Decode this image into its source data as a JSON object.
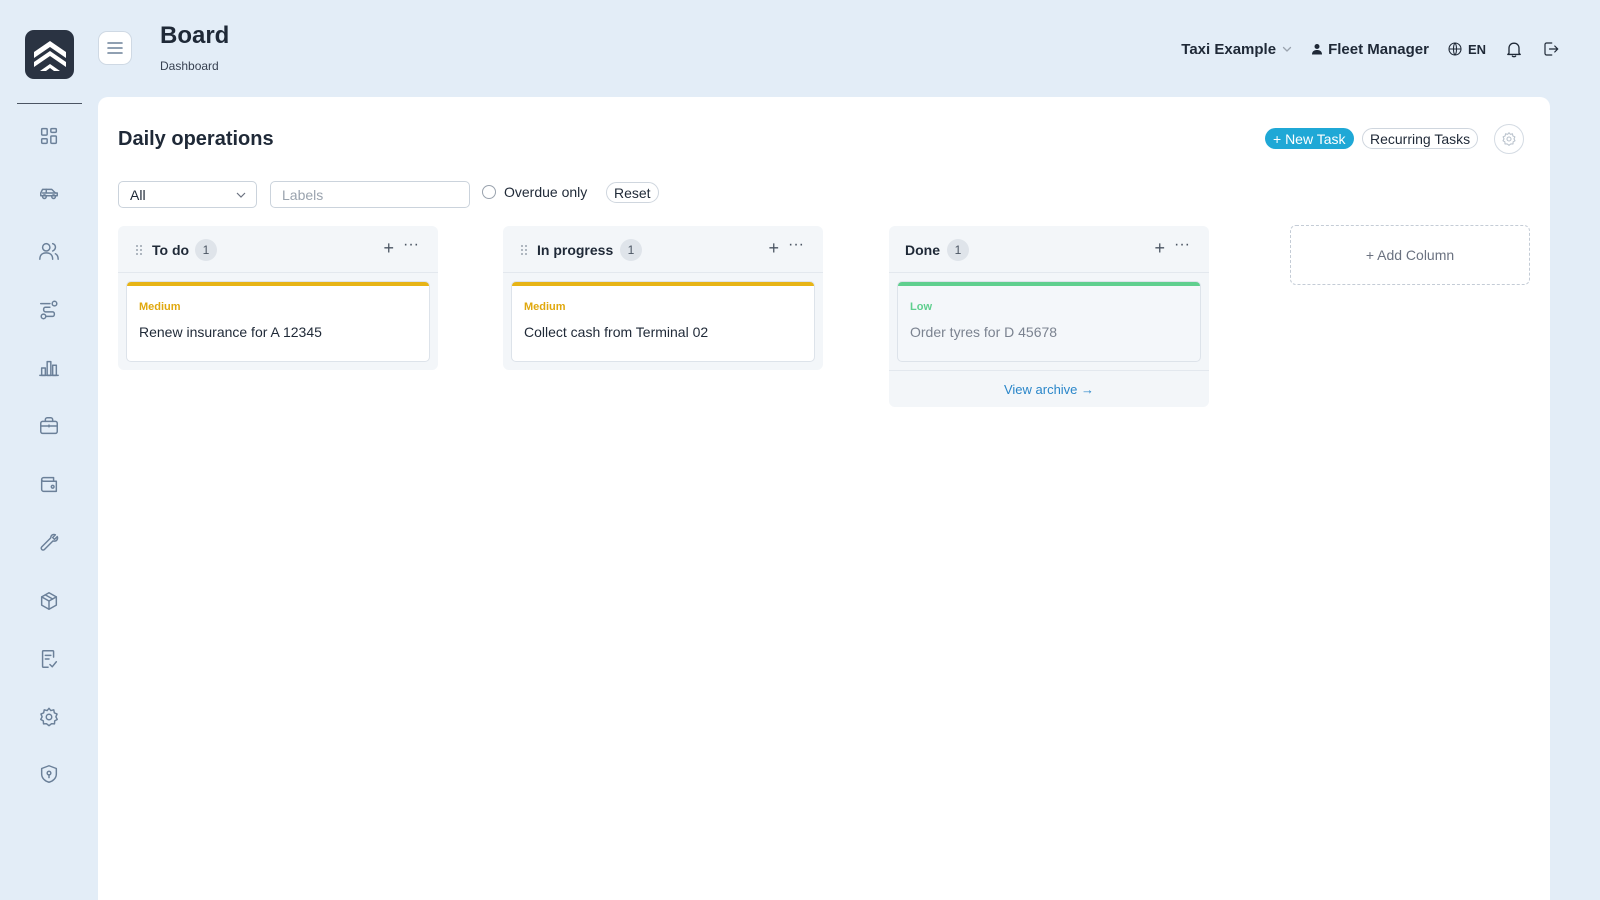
{
  "header": {
    "title": "Board",
    "subtitle": "Dashboard",
    "company": "Taxi Example",
    "user": "Fleet Manager",
    "language": "EN"
  },
  "sidebar": {
    "items": [
      {
        "name": "dashboard",
        "icon": "grid-icon"
      },
      {
        "name": "vehicles",
        "icon": "car-icon"
      },
      {
        "name": "drivers",
        "icon": "users-icon"
      },
      {
        "name": "routes",
        "icon": "route-icon"
      },
      {
        "name": "reports",
        "icon": "bar-chart-icon"
      },
      {
        "name": "jobs",
        "icon": "briefcase-icon"
      },
      {
        "name": "wallet",
        "icon": "wallet-icon"
      },
      {
        "name": "maintenance",
        "icon": "wrench-icon"
      },
      {
        "name": "inventory",
        "icon": "box-icon"
      },
      {
        "name": "checklists",
        "icon": "checklist-icon"
      },
      {
        "name": "settings",
        "icon": "gear-icon"
      },
      {
        "name": "security",
        "icon": "shield-icon"
      }
    ]
  },
  "board": {
    "title": "Daily operations",
    "new_task": "+ New Task",
    "recurring_tasks": "Recurring Tasks",
    "add_column": "+ Add Column"
  },
  "filters": {
    "assignee": "All",
    "labels_placeholder": "Labels",
    "overdue_only": "Overdue only",
    "reset": "Reset"
  },
  "columns": [
    {
      "title": "To do",
      "count": "1",
      "cards": [
        {
          "priority": "Medium",
          "title": "Renew insurance for A 12345"
        }
      ]
    },
    {
      "title": "In progress",
      "count": "1",
      "cards": [
        {
          "priority": "Medium",
          "title": "Collect cash from Terminal 02"
        }
      ]
    },
    {
      "title": "Done",
      "count": "1",
      "cards": [
        {
          "priority": "Low",
          "title": "Order tyres for D 45678"
        }
      ],
      "archive_link": "View archive →"
    }
  ],
  "colors": {
    "accent": "#1fa8d6",
    "priority_medium": "#e7b416",
    "priority_low": "#5fcf8e",
    "link": "#2a86c9"
  }
}
